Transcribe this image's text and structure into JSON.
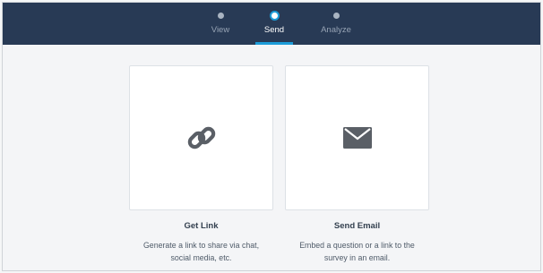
{
  "stepper": {
    "steps": [
      {
        "label": "View",
        "active": false
      },
      {
        "label": "Send",
        "active": true
      },
      {
        "label": "Analyze",
        "active": false
      }
    ],
    "colors": {
      "bar": "#283a55",
      "accent": "#1c9cd8"
    }
  },
  "options": [
    {
      "icon": "link-icon",
      "title": "Get Link",
      "desc_line1": "Generate a link to share via chat,",
      "desc_line2": "social media, etc."
    },
    {
      "icon": "envelope-icon",
      "title": "Send Email",
      "desc_line1": "Embed a question or a link to the",
      "desc_line2": "survey in an email."
    }
  ]
}
